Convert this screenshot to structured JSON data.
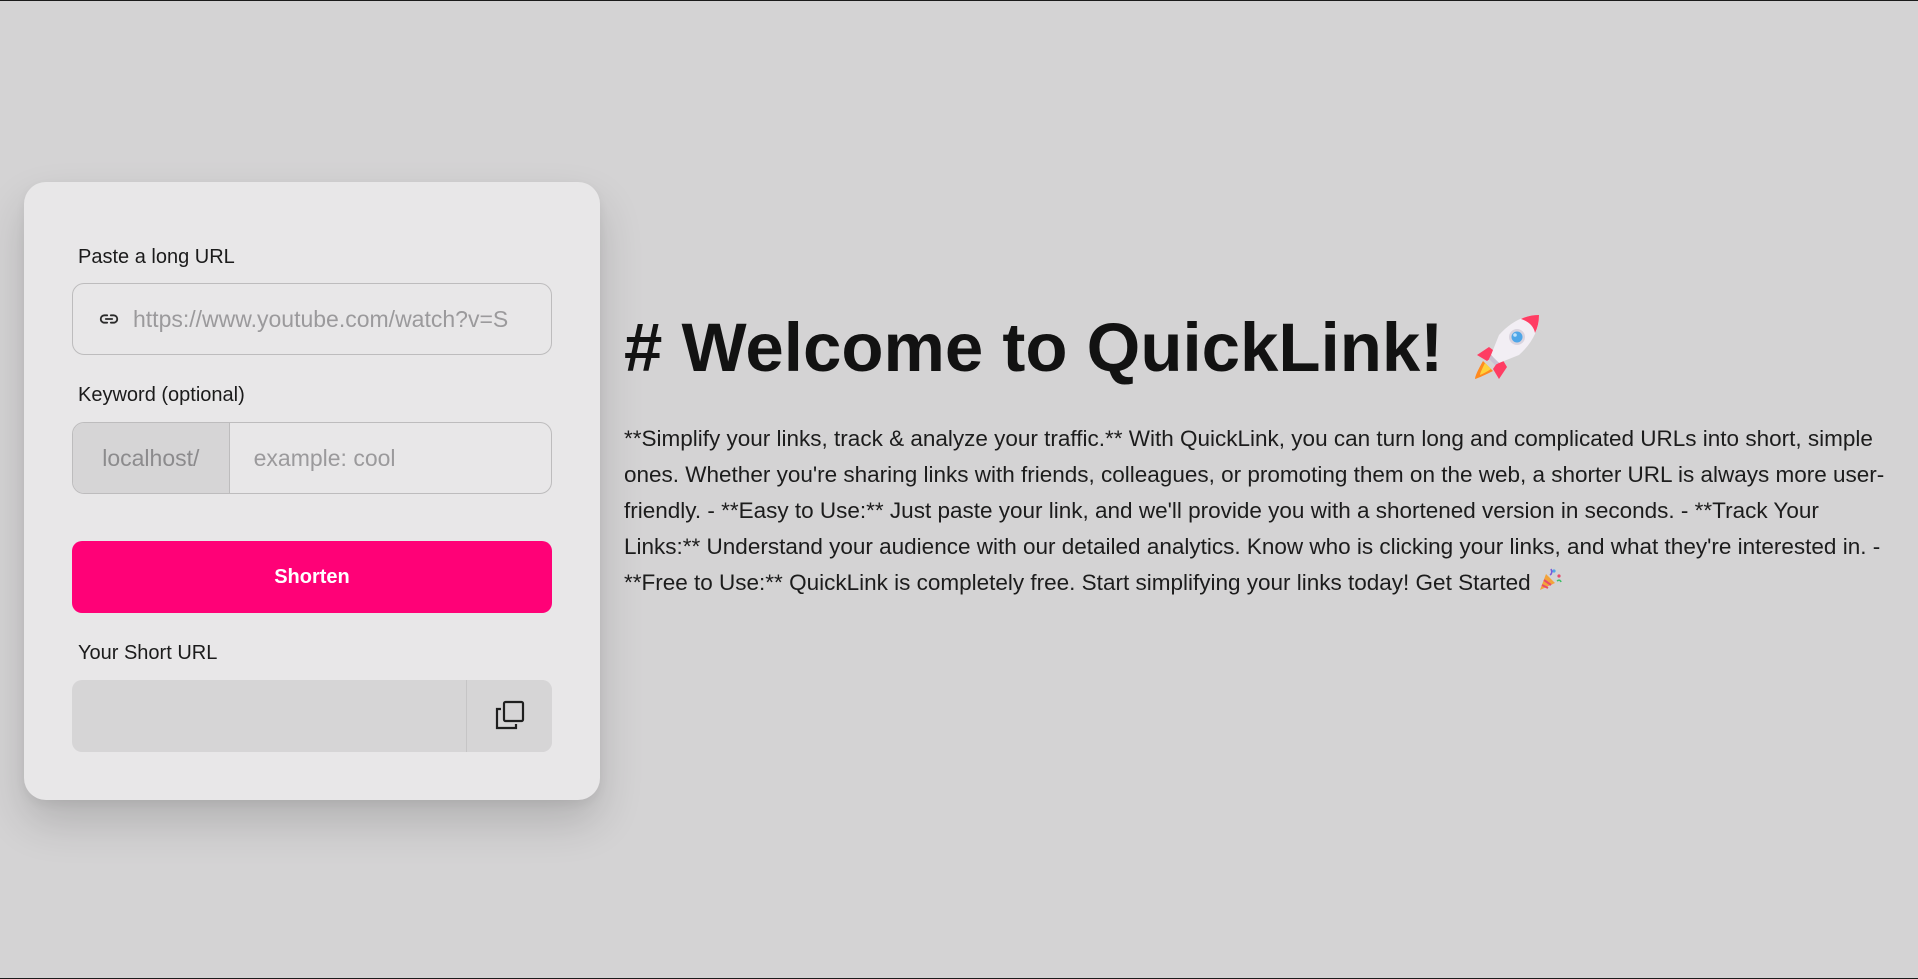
{
  "form": {
    "url_label": "Paste a long URL",
    "url_placeholder": "https://www.youtube.com/watch?v=S",
    "url_value": "",
    "keyword_label": "Keyword (optional)",
    "keyword_prefix": "localhost/",
    "keyword_placeholder": "example: cool",
    "keyword_value": "",
    "shorten_label": "Shorten",
    "short_url_label": "Your Short URL",
    "short_url_value": "",
    "icons": {
      "url_field": "link-icon",
      "copy": "copy-icon"
    }
  },
  "hero": {
    "title": "# Welcome to QuickLink!",
    "title_icon": "rocket-icon",
    "body": "**Simplify your links, track & analyze your traffic.** With QuickLink, you can turn long and complicated URLs into short, simple ones. Whether you're sharing links with friends, colleagues, or promoting them on the web, a shorter URL is always more user-friendly. - **Easy to Use:** Just paste your link, and we'll provide you with a shortened version in seconds. - **Track Your Links:** Understand your audience with our detailed analytics. Know who is clicking your links, and what they're interested in. - **Free to Use:** QuickLink is completely free. Start simplifying your links today! Get Started",
    "body_end_icon": "party-popper-icon"
  },
  "colors": {
    "background": "#d4d3d4",
    "card": "#e8e7e8",
    "accent": "#ff0177",
    "field_gray": "#d6d5d6"
  }
}
